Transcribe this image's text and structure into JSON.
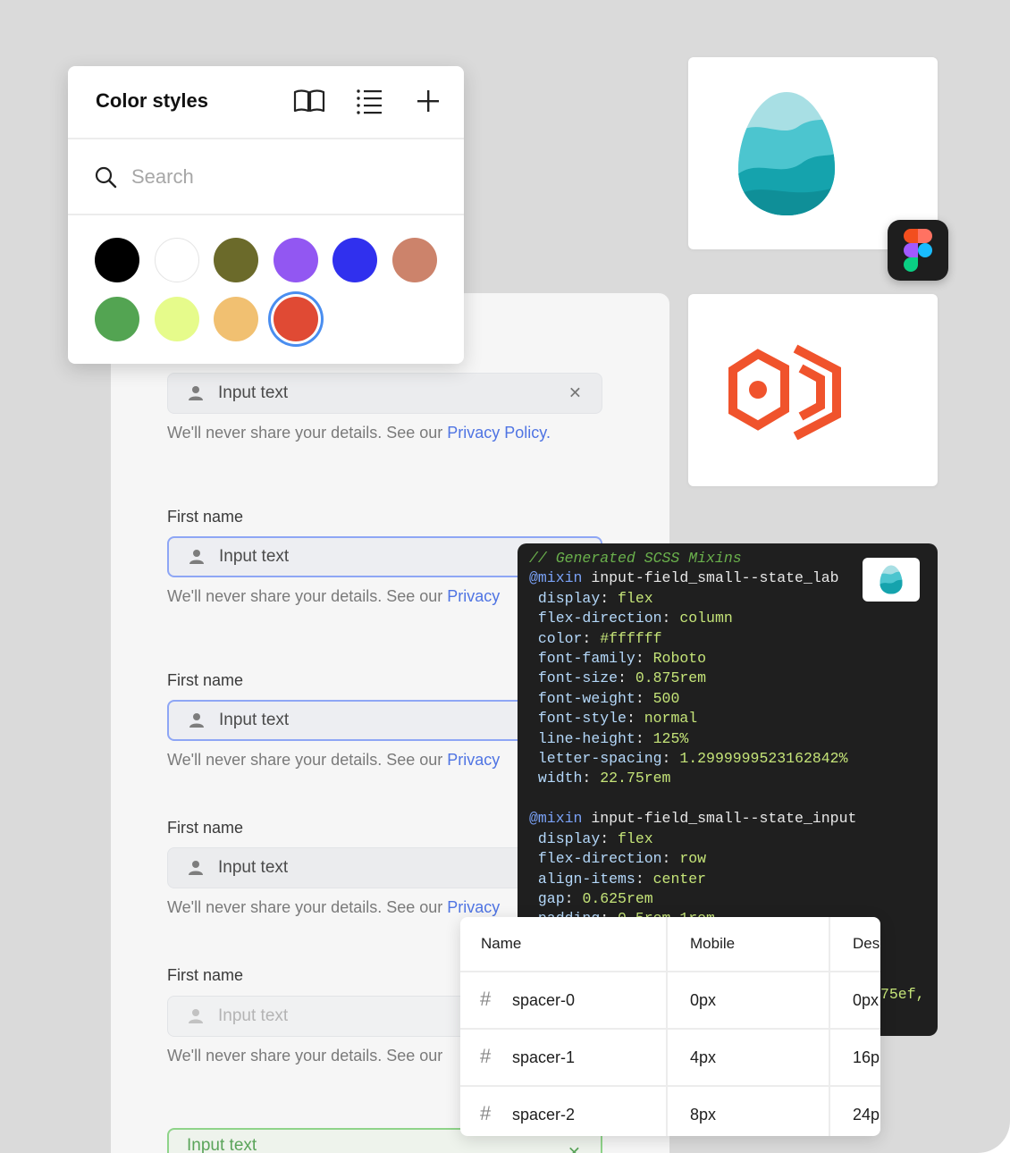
{
  "color_styles": {
    "title": "Color styles",
    "search_placeholder": "Search",
    "toolbar_icons": [
      "book-icon",
      "list-icon",
      "plus-icon"
    ],
    "swatches": [
      "#000000",
      "#ffffff",
      "#6b6a2a",
      "#9257f2",
      "#3030ee",
      "#cc836b",
      "#53a452",
      "#e6fb8b",
      "#f1c071",
      "#e04a34"
    ],
    "selected_swatch": "#e04a34"
  },
  "form": {
    "fields": [
      {
        "label": "",
        "value": "Input text",
        "helper": "We'll never share your details. See our ",
        "link": "Privacy Policy.",
        "state": "default-clear"
      },
      {
        "label": "First name",
        "value": "Input text",
        "helper": "We'll never share your details. See our ",
        "link": "Privacy",
        "state": "focused"
      },
      {
        "label": "First name",
        "value": "Input text",
        "helper": "We'll never share your details. See our ",
        "link": "Privacy",
        "state": "focused"
      },
      {
        "label": "First name",
        "value": "Input text",
        "helper": "We'll never share your details. See our ",
        "link": "Privacy",
        "state": "default"
      },
      {
        "label": "First name",
        "value": "Input text",
        "helper": "We'll never share your details. See our",
        "link": "",
        "state": "disabled"
      },
      {
        "label": "",
        "value": "Input text",
        "helper": "",
        "link": "",
        "state": "success"
      }
    ]
  },
  "cards": {
    "egg_colors": [
      "#a8dfe4",
      "#4cc5cf",
      "#15a3ad"
    ],
    "hex_logo_color": "#f0532c",
    "figma_colors": [
      "#f24e1e",
      "#ff7262",
      "#a259ff",
      "#1abcfe",
      "#0acf83"
    ]
  },
  "code": {
    "comment": "// Generated SCSS Mixins",
    "blocks": [
      {
        "keyword": "@mixin",
        "name": " input-field_small--state_lab",
        "props": [
          [
            "display",
            "flex"
          ],
          [
            "flex-direction",
            "column"
          ],
          [
            "color",
            "#ffffff"
          ],
          [
            "font-family",
            "Roboto"
          ],
          [
            "font-size",
            "0.875rem"
          ],
          [
            "font-weight",
            "500"
          ],
          [
            "font-style",
            "normal"
          ],
          [
            "line-height",
            "125%"
          ],
          [
            "letter-spacing",
            "1.2999999523162842%"
          ],
          [
            "width",
            "22.75rem"
          ]
        ]
      },
      {
        "keyword": "@mixin",
        "name": " input-field_small--state_input",
        "props": [
          [
            "display",
            "flex"
          ],
          [
            "flex-direction",
            "row"
          ],
          [
            "align-items",
            "center"
          ],
          [
            "gap",
            "0.625rem"
          ],
          [
            "padding",
            "0.5rem 1rem"
          ]
        ]
      }
    ],
    "tail_text": "75ef,"
  },
  "tokens": {
    "headers": [
      "Name",
      "Mobile",
      "Des"
    ],
    "rows": [
      {
        "name": "spacer-0",
        "mobile": "0px",
        "desktop": "0px"
      },
      {
        "name": "spacer-1",
        "mobile": "4px",
        "desktop": "16p"
      },
      {
        "name": "spacer-2",
        "mobile": "8px",
        "desktop": "24p"
      }
    ]
  }
}
